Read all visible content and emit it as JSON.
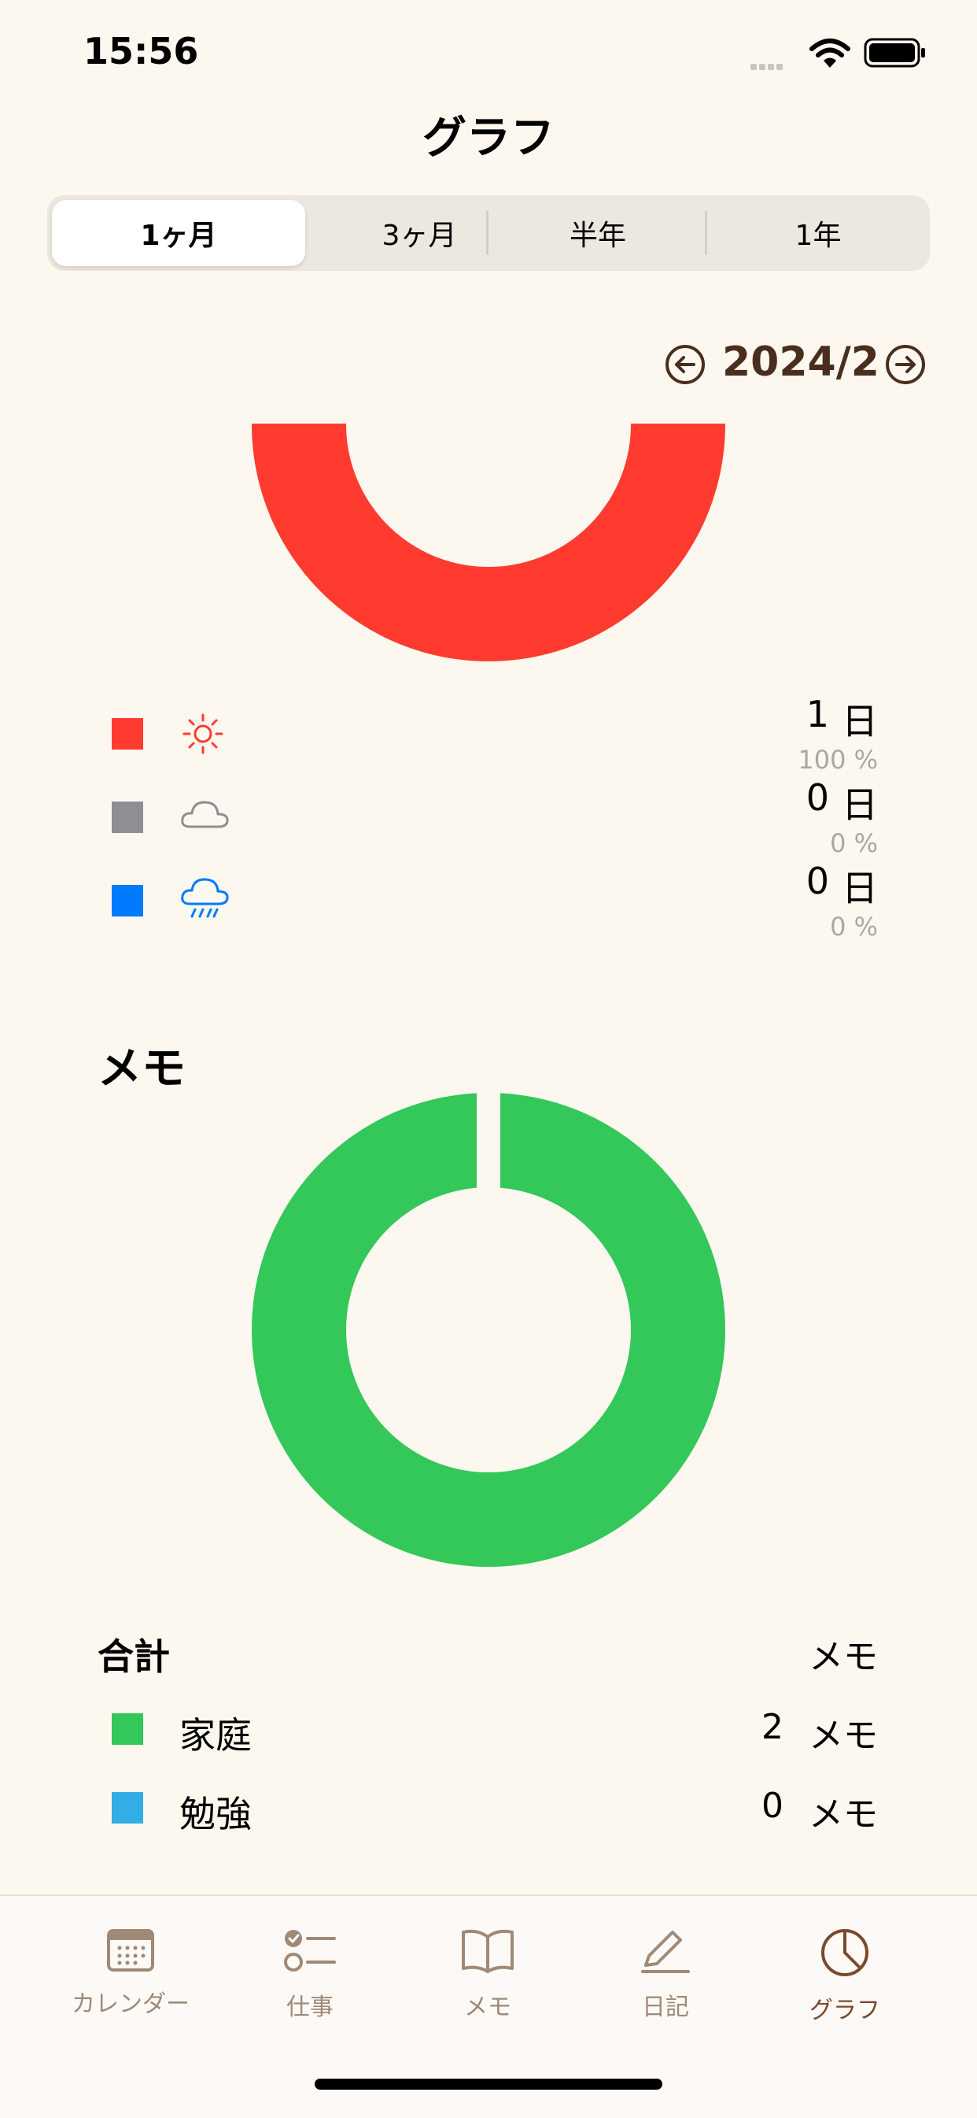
{
  "status_bar": {
    "time": "15:56"
  },
  "header": {
    "title": "グラフ"
  },
  "segments": [
    {
      "label": "1ヶ月",
      "selected": true
    },
    {
      "label": "3ヶ月",
      "selected": false
    },
    {
      "label": "半年",
      "selected": false
    },
    {
      "label": "1年",
      "selected": false
    }
  ],
  "month_nav": {
    "label": "2024/2"
  },
  "weather": {
    "items": [
      {
        "icon": "sun-icon",
        "color": "#ff3b30",
        "count": "1",
        "unit": "日",
        "percent": "100 %"
      },
      {
        "icon": "cloud-icon",
        "color": "#8e8e93",
        "count": "0",
        "unit": "日",
        "percent": "0 %"
      },
      {
        "icon": "rain-icon",
        "color": "#007aff",
        "count": "0",
        "unit": "日",
        "percent": "0 %"
      }
    ]
  },
  "memo": {
    "heading": "メモ",
    "total_label": "合計",
    "total_unit": "メモ",
    "categories": [
      {
        "label": "家庭",
        "color": "#34c759",
        "count": "2",
        "unit": "メモ"
      },
      {
        "label": "勉強",
        "color": "#32ade6",
        "count": "0",
        "unit": "メモ"
      }
    ]
  },
  "chart_data": [
    {
      "type": "pie",
      "categories": [
        "sun",
        "cloud",
        "rain"
      ],
      "values": [
        1,
        0,
        0
      ],
      "colors": [
        "#ff3b30",
        "#8e8e93",
        "#007aff"
      ]
    },
    {
      "type": "pie",
      "categories": [
        "家庭",
        "勉強"
      ],
      "values": [
        2,
        0
      ],
      "colors": [
        "#34c759",
        "#32ade6"
      ]
    }
  ],
  "tabbar": {
    "tabs": [
      {
        "label": "カレンダー",
        "icon": "calendar-icon",
        "active": false
      },
      {
        "label": "仕事",
        "icon": "checklist-icon",
        "active": false
      },
      {
        "label": "メモ",
        "icon": "book-icon",
        "active": false
      },
      {
        "label": "日記",
        "icon": "pencil-icon",
        "active": false
      },
      {
        "label": "グラフ",
        "icon": "pie-chart-icon",
        "active": true
      }
    ]
  }
}
